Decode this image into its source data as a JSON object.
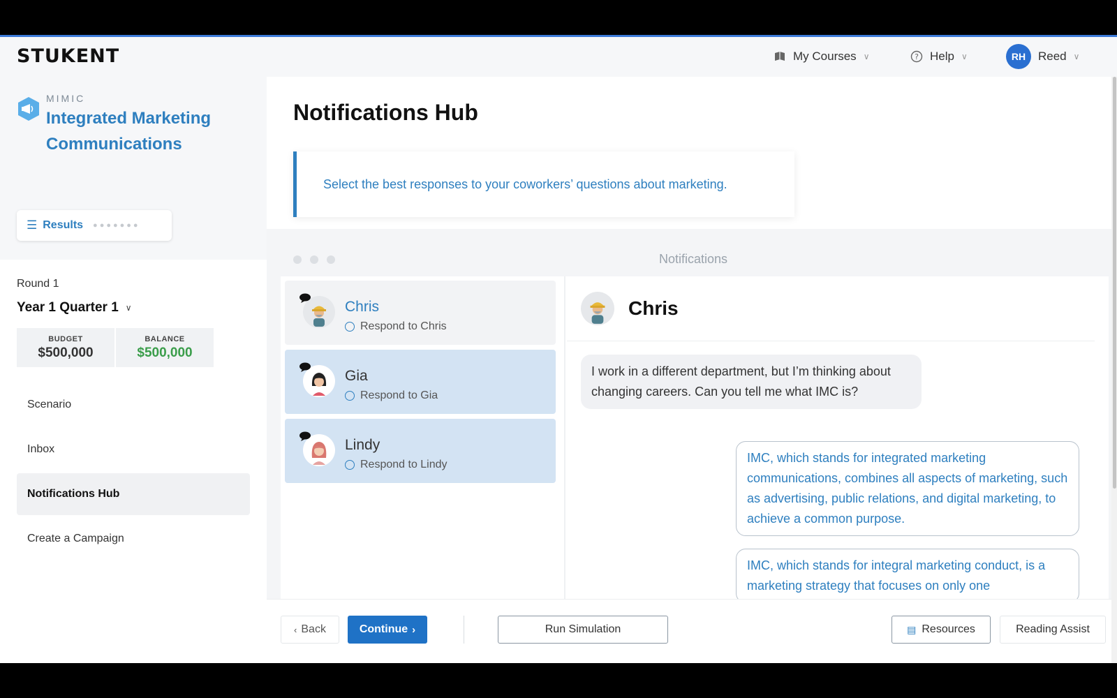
{
  "header": {
    "logo": "STUKENT",
    "my_courses": "My Courses",
    "help": "Help",
    "user_initials": "RH",
    "user_name": "Reed"
  },
  "sidebar": {
    "product_eyebrow": "MIMIC",
    "product_title": "Integrated Marketing Communications",
    "results_label": "Results",
    "round_label": "Round 1",
    "period": "Year 1 Quarter 1",
    "budget_caption": "BUDGET",
    "budget_value": "$500,000",
    "balance_caption": "BALANCE",
    "balance_value": "$500,000",
    "nav": [
      {
        "label": "Scenario"
      },
      {
        "label": "Inbox"
      },
      {
        "label": "Notifications Hub"
      },
      {
        "label": "Create a Campaign"
      }
    ]
  },
  "main": {
    "title": "Notifications Hub",
    "instruction": "Select the best responses to your coworkers’ questions about marketing.",
    "window_title": "Notifications",
    "contacts": [
      {
        "name": "Chris",
        "status": "Respond to Chris"
      },
      {
        "name": "Gia",
        "status": "Respond to Gia"
      },
      {
        "name": "Lindy",
        "status": "Respond to Lindy"
      }
    ],
    "thread": {
      "name": "Chris",
      "question": "I work in a different department, but I’m thinking about changing careers. Can you tell me what IMC is?",
      "options": [
        "IMC, which stands for integrated marketing communications, combines all aspects of marketing, such as advertising, public relations, and digital marketing, to achieve a common purpose.",
        "IMC, which stands for integral marketing conduct, is a marketing strategy that focuses on only one"
      ]
    }
  },
  "footer": {
    "back": "Back",
    "continue": "Continue",
    "run_simulation": "Run Simulation",
    "resources": "Resources",
    "reading_assist": "Reading Assist"
  },
  "colors": {
    "accent_blue": "#2e7fbf",
    "primary_button": "#1f72c6",
    "balance_green": "#3a9d4a",
    "unread_contact": "#d3e3f3"
  },
  "icons": [
    "book-icon",
    "help-circle-icon",
    "chevron-down-icon",
    "megaphone-icon",
    "menu-icon",
    "chat-bubble-icon",
    "chevron-left-icon",
    "chevron-right-icon",
    "document-icon"
  ]
}
